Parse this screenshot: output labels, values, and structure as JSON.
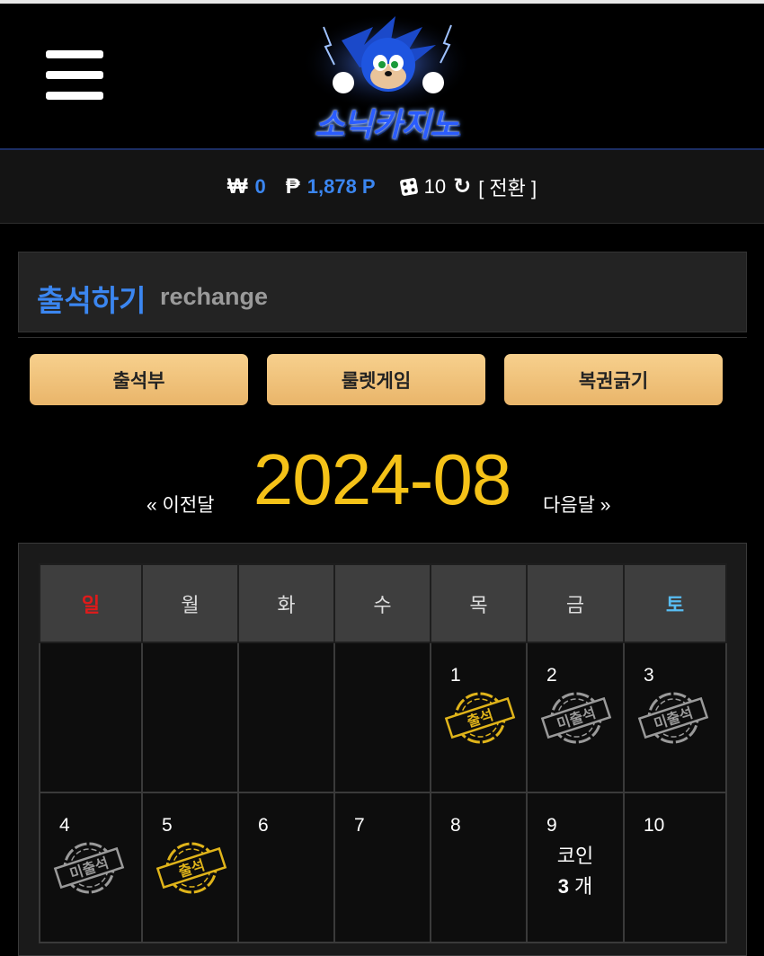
{
  "header": {
    "logo_text": "소닉카지노",
    "menu_icon": "hamburger-menu-icon"
  },
  "balance": {
    "won_symbol": "₩",
    "won_value": "0",
    "point_symbol": "₱",
    "point_value": "1,878 P",
    "chip_icon": "dice-icon",
    "chip_value": "10",
    "refresh_icon": "refresh-icon",
    "refresh_glyph": "↻",
    "convert_label": "[ 전환 ]",
    "value_color": "#3b86f0"
  },
  "section": {
    "title": "출석하기",
    "subtitle": "rechange"
  },
  "tabs": [
    {
      "label": "출석부"
    },
    {
      "label": "룰렛게임"
    },
    {
      "label": "복권긁기"
    }
  ],
  "month": {
    "title": "2024-08",
    "prev_label": "« 이전달",
    "next_label": "다음달 »",
    "title_color": "#f5c218"
  },
  "calendar": {
    "weekdays": [
      {
        "label": "일",
        "color": "#e01a1a"
      },
      {
        "label": "월",
        "color": "#dddddd"
      },
      {
        "label": "화",
        "color": "#dddddd"
      },
      {
        "label": "수",
        "color": "#dddddd"
      },
      {
        "label": "목",
        "color": "#dddddd"
      },
      {
        "label": "금",
        "color": "#dddddd"
      },
      {
        "label": "토",
        "color": "#58bdf2"
      }
    ],
    "weeks": [
      [
        {
          "day": ""
        },
        {
          "day": ""
        },
        {
          "day": ""
        },
        {
          "day": ""
        },
        {
          "day": "1",
          "stamp": "출석",
          "stamp_status": "attended"
        },
        {
          "day": "2",
          "stamp": "미출석",
          "stamp_status": "absent"
        },
        {
          "day": "3",
          "stamp": "미출석",
          "stamp_status": "absent"
        }
      ],
      [
        {
          "day": "4",
          "stamp": "미출석",
          "stamp_status": "absent"
        },
        {
          "day": "5",
          "stamp": "출석",
          "stamp_status": "attended"
        },
        {
          "day": "6"
        },
        {
          "day": "7"
        },
        {
          "day": "8"
        },
        {
          "day": "9",
          "coin_label": "코인",
          "coin_count": "3",
          "coin_unit": "개"
        },
        {
          "day": "10"
        }
      ]
    ],
    "stamp_colors": {
      "attended": "#e0b41a",
      "absent": "#9a9a9a"
    }
  }
}
